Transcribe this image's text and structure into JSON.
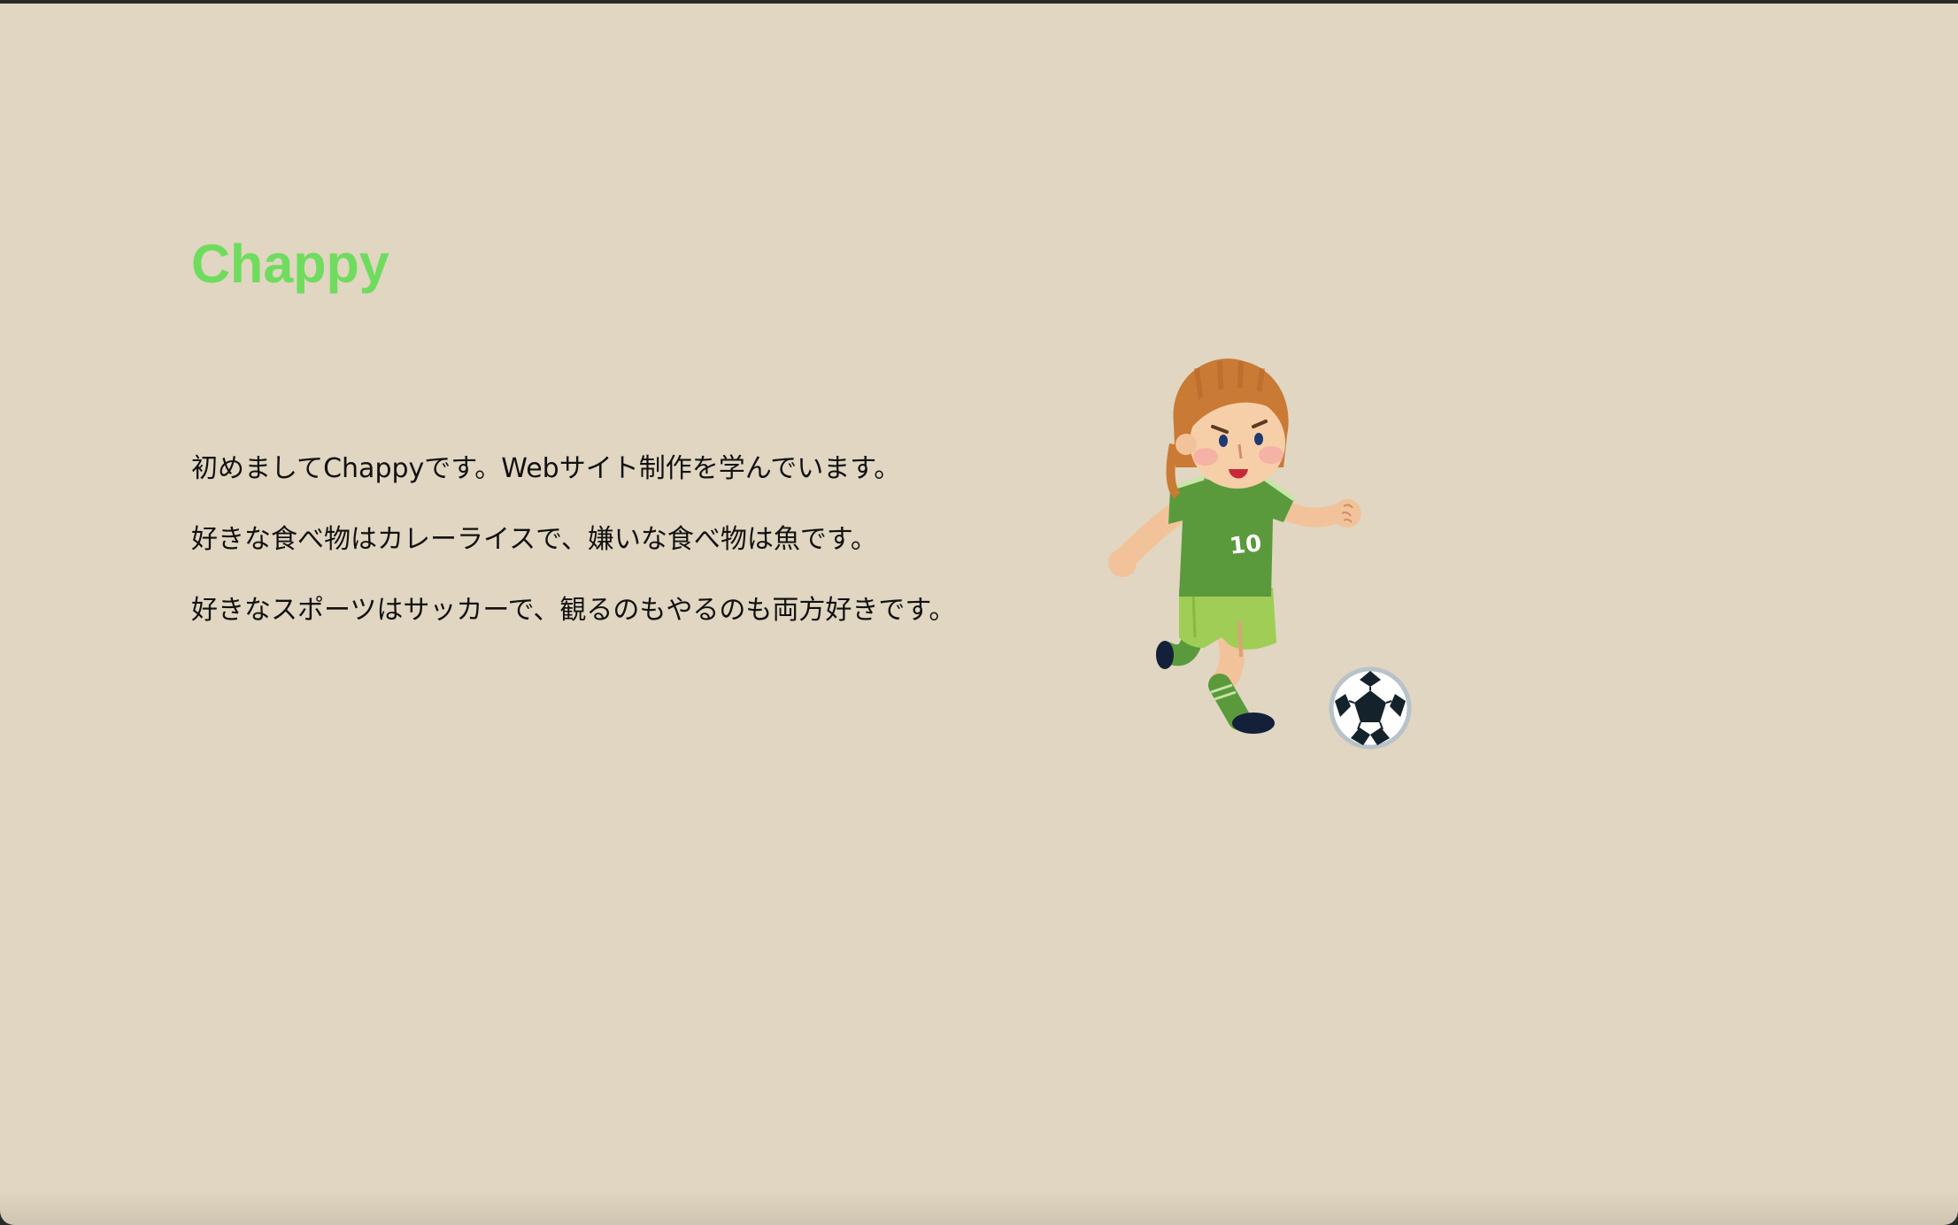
{
  "header": {
    "site_title": "Chappy"
  },
  "intro": {
    "lines": [
      "初めましてChappyです。Webサイト制作を学んでいます。",
      "好きな食べ物はカレーライスで、嫌いな食べ物は魚です。",
      "好きなスポーツはサッカーで、観るのもやるのも両方好きです。"
    ]
  },
  "illustration": {
    "subject": "soccer-player-icon",
    "jersey_number": "10",
    "colors": {
      "jersey": "#5a9a3c",
      "shorts": "#9fcd55",
      "hair": "#c97a35",
      "ball": "#ffffff"
    }
  },
  "theme": {
    "background": "#e0d6c1",
    "title_color": "#6fdc5e",
    "text_color": "#111111"
  }
}
